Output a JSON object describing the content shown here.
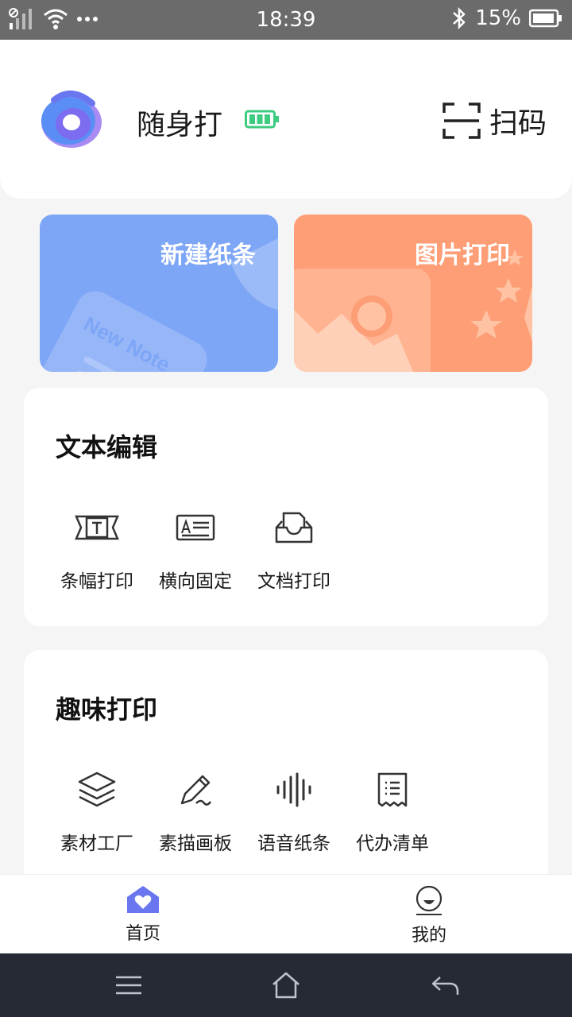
{
  "status_bar": {
    "time": "18:39",
    "battery_percent": "15%",
    "icons": [
      "no-sim-icon",
      "signal-icon",
      "wifi-icon",
      "more-dots-icon",
      "bluetooth-icon",
      "battery-icon"
    ]
  },
  "header": {
    "app_name": "随身打",
    "scan_label": "扫码",
    "icons": [
      "app-logo",
      "battery-full-icon",
      "scan-icon"
    ]
  },
  "banners": [
    {
      "title": "新建纸条",
      "art_text": "New Note",
      "color": "#7ea6f6"
    },
    {
      "title": "图片打印",
      "color": "#fe9e76"
    }
  ],
  "text_edit": {
    "title": "文本编辑",
    "items": [
      {
        "label": "条幅打印",
        "icon": "banner-print-icon"
      },
      {
        "label": "横向固定",
        "icon": "horizontal-fixed-icon"
      },
      {
        "label": "文档打印",
        "icon": "document-print-icon"
      }
    ]
  },
  "fun_print": {
    "title": "趣味打印",
    "items": [
      {
        "label": "素材工厂",
        "icon": "layers-icon"
      },
      {
        "label": "素描画板",
        "icon": "pencil-icon"
      },
      {
        "label": "语音纸条",
        "icon": "voice-wave-icon"
      },
      {
        "label": "代办清单",
        "icon": "checklist-icon"
      }
    ]
  },
  "tabbar": {
    "home_label": "首页",
    "mine_label": "我的",
    "active_color": "#6a76f0"
  },
  "system_nav": {
    "icons": [
      "menu-icon",
      "home-icon",
      "back-icon"
    ]
  }
}
